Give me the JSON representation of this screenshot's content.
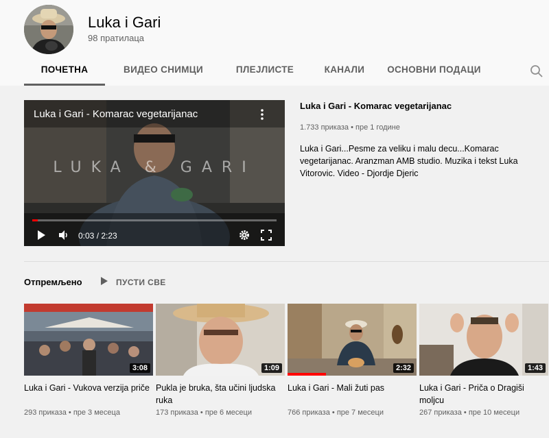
{
  "channel": {
    "name": "Luka i Gari",
    "subscribers": "98 пратилаца"
  },
  "tabs": [
    {
      "label": "ПОЧЕТНА",
      "active": true
    },
    {
      "label": "ВИДЕО СНИМЦИ",
      "active": false
    },
    {
      "label": "ПЛЕЈЛИСТЕ",
      "active": false
    },
    {
      "label": "КАНАЛИ",
      "active": false
    },
    {
      "label": "ОСНОВНИ ПОДАЦИ",
      "active": false
    }
  ],
  "featured": {
    "player_title": "Luka i Gari - Komarac vegetarijanac",
    "watermark": "LUKA & GARI",
    "time": "0:03 / 2:23",
    "progress": 0.022,
    "title": "Luka i Gari -  Komarac vegetarijanac",
    "views": "1.733 приказа",
    "age": "пре 1 године",
    "description": "Luka i Gari...Pesme za veliku i malu decu...Komarac vegetarijanac. Aranzman AMB studio. Muzika i tekst Luka Vitorovic. Video - Djordje Djeric"
  },
  "shelf": {
    "title": "Отпремљено",
    "play_all": "ПУСТИ СВЕ"
  },
  "videos": [
    {
      "title": "Luka i Gari - Vukova verzija priče",
      "views": "293 приказа",
      "age": "пре 3 месеца",
      "duration": "3:08",
      "watched": 0
    },
    {
      "title": "Pukla je bruka, šta učini ljudska ruka",
      "views": "173 приказа",
      "age": "пре 6 месеци",
      "duration": "1:09",
      "watched": 0
    },
    {
      "title": "Luka i Gari - Mali žuti pas",
      "views": "766 приказа",
      "age": "пре 7 месеци",
      "duration": "2:32",
      "watched": 0.3
    },
    {
      "title": "Luka i Gari - Priča o Dragiši moljcu",
      "views": "267 приказа",
      "age": "пре 10 месеци",
      "duration": "1:43",
      "watched": 0
    }
  ],
  "colors": {
    "accent_red": "#ff0000",
    "text_primary": "#030303",
    "text_secondary": "#606060",
    "background": "#f9f9f9",
    "content_bg": "#f1f1f1"
  }
}
